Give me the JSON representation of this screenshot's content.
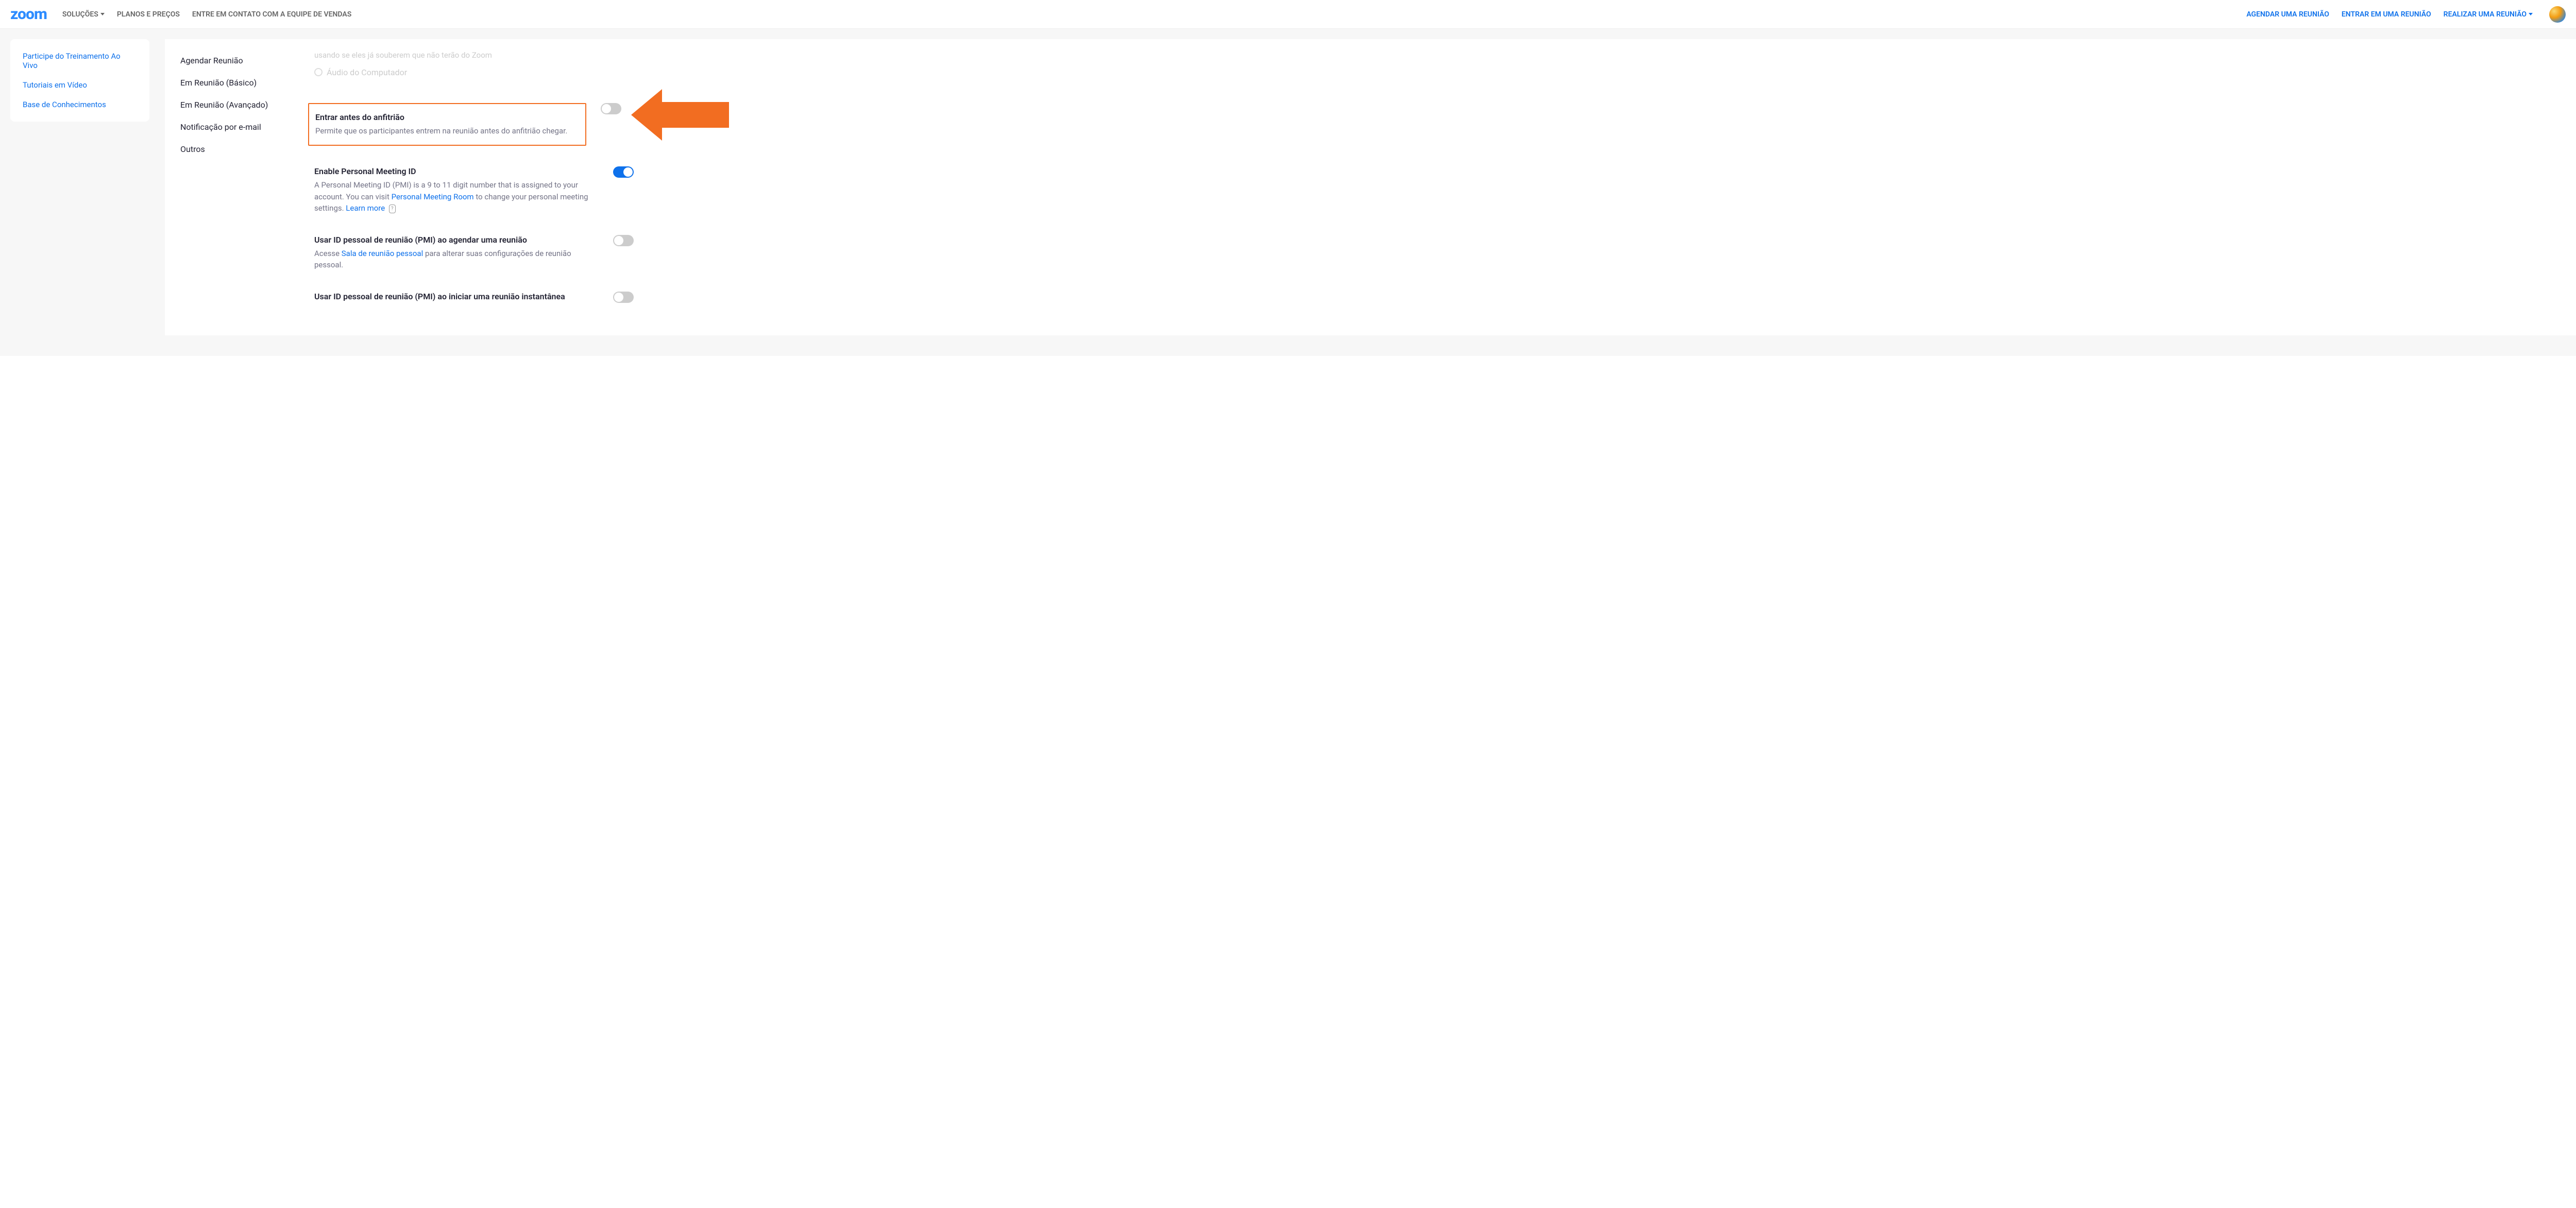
{
  "header": {
    "logo": "zoom",
    "nav_left": {
      "solutions": "SOLUÇÕES",
      "pricing": "PLANOS E PREÇOS",
      "contact_sales": "ENTRE EM CONTATO COM A EQUIPE DE VENDAS"
    },
    "nav_right": {
      "schedule": "AGENDAR UMA REUNIÃO",
      "join": "ENTRAR EM UMA REUNIÃO",
      "host": "REALIZAR UMA REUNIÃO"
    }
  },
  "sidebar": {
    "training": "Participe do Treinamento Ao Vivo",
    "videos": "Tutoriais em Vídeo",
    "kb": "Base de Conhecimentos"
  },
  "subnav": {
    "schedule": "Agendar Reunião",
    "in_meeting_basic": "Em Reunião (Básico)",
    "in_meeting_adv": "Em Reunião (Avançado)",
    "email_notif": "Notificação por e-mail",
    "others": "Outros"
  },
  "faded": {
    "line": "usando se eles já souberem que não terão do Zoom",
    "radio": "Áudio do Computador"
  },
  "settings": {
    "join_before_host": {
      "title": "Entrar antes do anfitrião",
      "desc": "Permite que os participantes entrem na reunião antes do anfitrião chegar.",
      "enabled": false
    },
    "enable_pmi": {
      "title": "Enable Personal Meeting ID",
      "desc_pre": "A Personal Meeting ID (PMI) is a 9 to 11 digit number that is assigned to your account. You can visit ",
      "link1": "Personal Meeting Room",
      "desc_mid": " to change your personal meeting settings. ",
      "link2": "Learn more",
      "enabled": true
    },
    "use_pmi_schedule": {
      "title": "Usar ID pessoal de reunião (PMI) ao agendar uma reunião",
      "desc_pre": "Acesse ",
      "link1": "Sala de reunião pessoal",
      "desc_post": " para alterar suas configurações de reunião pessoal.",
      "enabled": false
    },
    "use_pmi_instant": {
      "title": "Usar ID pessoal de reunião (PMI) ao iniciar uma reunião instantânea",
      "enabled": false
    }
  },
  "colors": {
    "accent": "#0E71EB",
    "highlight": "#F26D21"
  }
}
